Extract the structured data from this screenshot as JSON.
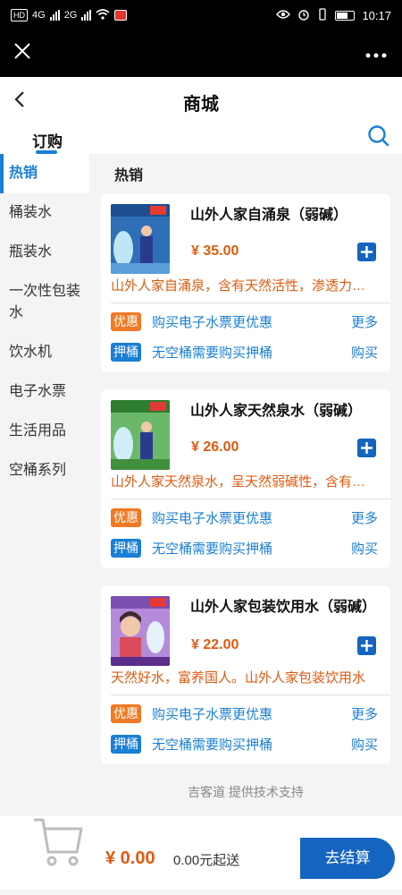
{
  "status": {
    "time": "10:17",
    "hd": "HD",
    "net1": "4G",
    "net2": "2G"
  },
  "page": {
    "title": "商城",
    "tab": "订购"
  },
  "sidebar": {
    "items": [
      {
        "label": "热销",
        "active": true
      },
      {
        "label": "桶装水",
        "active": false
      },
      {
        "label": "瓶装水",
        "active": false
      },
      {
        "label": "一次性包装水",
        "active": false
      },
      {
        "label": "饮水机",
        "active": false
      },
      {
        "label": "电子水票",
        "active": false
      },
      {
        "label": "生活用品",
        "active": false
      },
      {
        "label": "空桶系列",
        "active": false
      }
    ]
  },
  "section": {
    "title": "热销"
  },
  "products": [
    {
      "name": "山外人家自涌泉（弱碱）",
      "price": "¥ 35.00",
      "desc": "山外人家自涌泉，含有天然活性，渗透力强，易吸收",
      "promo": {
        "tag": "优惠",
        "text": "购买电子水票更优惠",
        "link": "更多"
      },
      "deposit": {
        "tag": "押桶",
        "text": "无空桶需要购买押桶",
        "link": "购买"
      }
    },
    {
      "name": "山外人家天然泉水（弱碱）",
      "price": "¥ 26.00",
      "desc": "山外人家天然泉水，呈天然弱碱性，含有多种矿物质",
      "promo": {
        "tag": "优惠",
        "text": "购买电子水票更优惠",
        "link": "更多"
      },
      "deposit": {
        "tag": "押桶",
        "text": "无空桶需要购买押桶",
        "link": "购买"
      }
    },
    {
      "name": "山外人家包装饮用水（弱碱）",
      "price": "¥ 22.00",
      "desc": "天然好水，富养国人。山外人家包装饮用水",
      "promo": {
        "tag": "优惠",
        "text": "购买电子水票更优惠",
        "link": "更多"
      },
      "deposit": {
        "tag": "押桶",
        "text": "无空桶需要购买押桶",
        "link": "购买"
      }
    }
  ],
  "footer_note": "吉客道 提供技术支持",
  "cart": {
    "price": "¥ 0.00",
    "min": "0.00元起送",
    "checkout": "去结算"
  },
  "colors": {
    "accent": "#1a7fd6",
    "price": "#e05a0e",
    "promo": "#ef7a23",
    "button": "#1565c0"
  }
}
